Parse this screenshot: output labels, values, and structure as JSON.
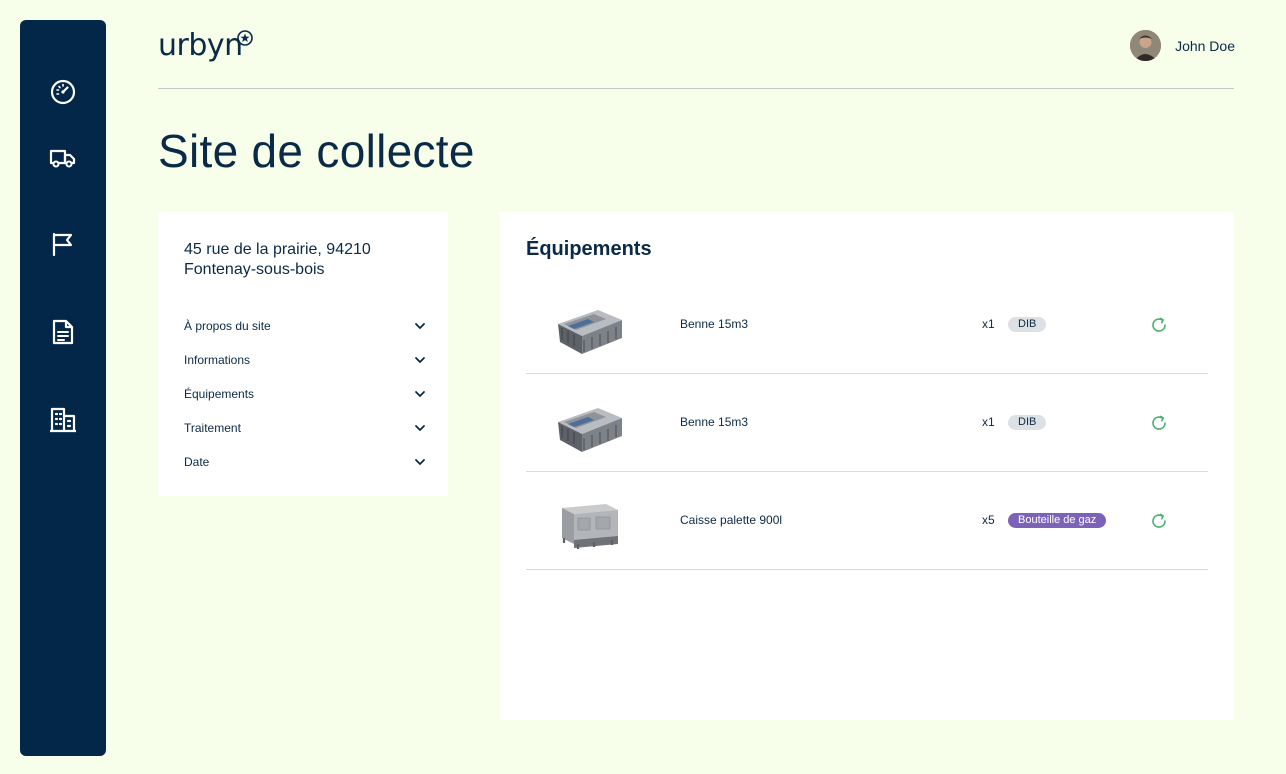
{
  "app": {
    "logo": "urbyn"
  },
  "user": {
    "name": "John Doe"
  },
  "sidebar": {
    "items": [
      {
        "icon": "dashboard-icon"
      },
      {
        "icon": "truck-icon"
      },
      {
        "icon": "flag-icon"
      },
      {
        "icon": "document-icon"
      },
      {
        "icon": "building-icon"
      }
    ]
  },
  "page": {
    "title": "Site de collecte"
  },
  "site": {
    "address_line1": "45 rue de la prairie, 94210",
    "address_line2": "Fontenay-sous-bois",
    "sections": [
      {
        "label": "À propos du site"
      },
      {
        "label": "Informations"
      },
      {
        "label": "Équipements"
      },
      {
        "label": "Traitement"
      },
      {
        "label": "Date"
      }
    ]
  },
  "equipments": {
    "title": "Équipements",
    "rows": [
      {
        "name": "Benne 15m3",
        "qty": "x1",
        "tag": "DIB",
        "tag_color": "#dde1e3",
        "image": "skip-container"
      },
      {
        "name": "Benne 15m3",
        "qty": "x1",
        "tag": "DIB",
        "tag_color": "#dde1e3",
        "image": "skip-container"
      },
      {
        "name": "Caisse palette 900l",
        "qty": "x5",
        "tag": "Bouteille de gaz",
        "tag_color": "#7d63b8",
        "image": "pallet-box"
      }
    ]
  },
  "colors": {
    "sidebar": "#022749",
    "background": "#f7fee9",
    "text": "#0b2a47",
    "refresh": "#4caf6e"
  }
}
